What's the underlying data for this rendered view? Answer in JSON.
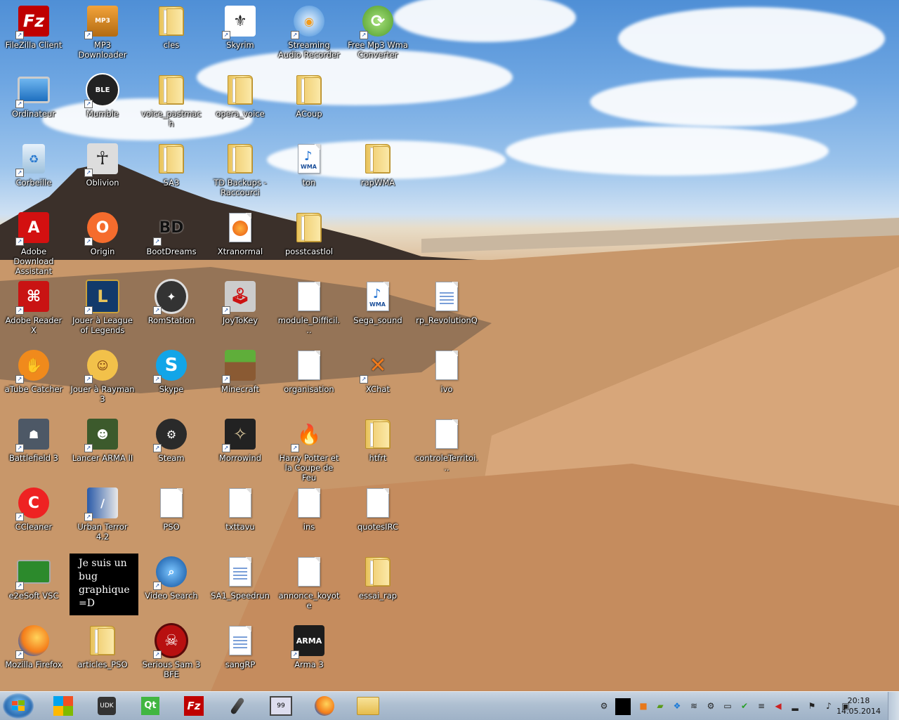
{
  "desktop": {
    "icons": [
      {
        "label": "FileZilla Client",
        "icon": "filezilla-icon"
      },
      {
        "label": "MP3 Downloader",
        "icon": "mp3-downloader-icon"
      },
      {
        "label": "cles",
        "icon": "folder-icon"
      },
      {
        "label": "Skyrim",
        "icon": "skyrim-icon"
      },
      {
        "label": "Streaming Audio Recorder",
        "icon": "audio-recorder-icon"
      },
      {
        "label": "Free Mp3 Wma Converter",
        "icon": "converter-icon"
      },
      {
        "label": "Ordinateur",
        "icon": "computer-icon"
      },
      {
        "label": "Mumble",
        "icon": "mumble-icon"
      },
      {
        "label": "voice_pastmach",
        "icon": "folder-icon"
      },
      {
        "label": "opera_voice",
        "icon": "folder-icon"
      },
      {
        "label": "ACoup",
        "icon": "folder-icon"
      },
      {
        "label": "Corbeille",
        "icon": "recycle-bin-icon"
      },
      {
        "label": "Oblivion",
        "icon": "oblivion-icon"
      },
      {
        "label": "SA3",
        "icon": "folder-icon"
      },
      {
        "label": "TD Backups - Raccourci",
        "icon": "folder-icon"
      },
      {
        "label": "ton",
        "icon": "wma-file-icon"
      },
      {
        "label": "rapWMA",
        "icon": "folder-icon"
      },
      {
        "label": "Adobe Download Assistant",
        "icon": "adobe-icon"
      },
      {
        "label": "Origin",
        "icon": "origin-icon"
      },
      {
        "label": "BootDreams",
        "icon": "bootdreams-icon"
      },
      {
        "label": "Xtranormal",
        "icon": "firefox-doc-icon"
      },
      {
        "label": "posstcastlol",
        "icon": "folder-icon"
      },
      {
        "label": "Adobe Reader X",
        "icon": "adobe-reader-icon"
      },
      {
        "label": "Jouer à League of Legends",
        "icon": "league-icon"
      },
      {
        "label": "RomStation",
        "icon": "romstation-icon"
      },
      {
        "label": "JoyToKey",
        "icon": "joystick-icon"
      },
      {
        "label": "module_Difficil...",
        "icon": "file-icon"
      },
      {
        "label": "Sega_sound",
        "icon": "wma-file-icon"
      },
      {
        "label": "rp_RevolutionQ",
        "icon": "text-doc-icon"
      },
      {
        "label": "aTube Catcher",
        "icon": "atube-icon"
      },
      {
        "label": "Jouer à Rayman 3",
        "icon": "rayman-icon"
      },
      {
        "label": "Skype",
        "icon": "skype-icon"
      },
      {
        "label": "Minecraft",
        "icon": "minecraft-icon"
      },
      {
        "label": "organisation",
        "icon": "file-icon"
      },
      {
        "label": "XChat",
        "icon": "xchat-icon"
      },
      {
        "label": "ivo",
        "icon": "file-icon"
      },
      {
        "label": "Battlefield 3",
        "icon": "battlefield-icon"
      },
      {
        "label": "Lancer ARMA II",
        "icon": "arma2-icon"
      },
      {
        "label": "Steam",
        "icon": "steam-icon"
      },
      {
        "label": "Morrowind",
        "icon": "morrowind-icon"
      },
      {
        "label": "Harry Potter et la Coupe de Feu",
        "icon": "harry-potter-icon"
      },
      {
        "label": "htfrt",
        "icon": "folder-icon"
      },
      {
        "label": "controleTerritoi...",
        "icon": "file-icon"
      },
      {
        "label": "CCleaner",
        "icon": "ccleaner-icon"
      },
      {
        "label": "Urban Terror 4.2",
        "icon": "urban-terror-icon"
      },
      {
        "label": "PSO",
        "icon": "file-icon"
      },
      {
        "label": "txttavu",
        "icon": "file-icon"
      },
      {
        "label": "ins",
        "icon": "file-icon"
      },
      {
        "label": "quotesIRC",
        "icon": "file-icon"
      },
      {
        "label": "e2eSoft VSC",
        "icon": "soundcard-icon"
      },
      {
        "label": "Video Search",
        "icon": "video-search-icon"
      },
      {
        "label": "SA1_Speedrun",
        "icon": "text-doc-icon"
      },
      {
        "label": "annonce_koyote",
        "icon": "file-icon"
      },
      {
        "label": "essai_rap",
        "icon": "folder-icon"
      },
      {
        "label": "Mozilla Firefox",
        "icon": "firefox-icon"
      },
      {
        "label": "articles_PSO",
        "icon": "folder-icon"
      },
      {
        "label": "Serious Sam 3 BFE",
        "icon": "serious-sam-icon"
      },
      {
        "label": "sangRP",
        "icon": "text-doc-icon"
      },
      {
        "label": "Arma 3",
        "icon": "arma3-icon"
      }
    ],
    "bug_box": "Je suis un bug graphique =D"
  },
  "taskbar": {
    "pinned": [
      "windows-live-icon",
      "udk-icon",
      "qt-icon",
      "filezilla-icon",
      "microphone-icon",
      "mirc-icon",
      "firefox-icon",
      "explorer-icon"
    ],
    "tray": [
      "steam-tray-icon",
      "black-square-icon",
      "orange-tray-icon",
      "nvidia-tray-icon",
      "dropbox-tray-icon",
      "network-tray-icon",
      "settings-tray-icon",
      "monitor-tray-icon",
      "checkmark-tray-icon",
      "wifi-tray-icon",
      "volume-tray-icon",
      "signal-tray-icon",
      "flag-tray-icon",
      "speaker-tray-icon",
      "cmd-tray-icon"
    ],
    "clock_time": "20:18",
    "clock_date": "14.05.2014"
  }
}
